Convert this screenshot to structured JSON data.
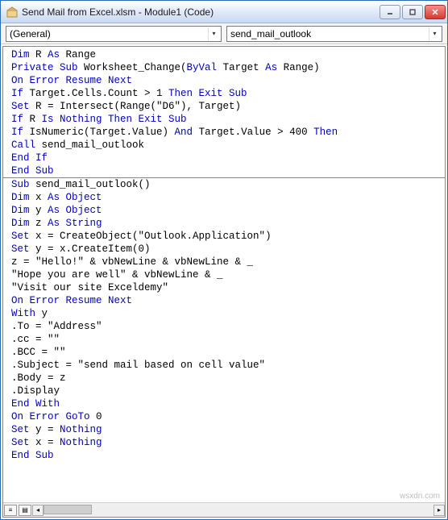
{
  "window": {
    "title": "Send Mail from Excel.xlsm - Module1 (Code)"
  },
  "toolbar": {
    "object_combo": "(General)",
    "proc_combo": "send_mail_outlook"
  },
  "code": {
    "line1_a": "Dim",
    "line1_b": " R ",
    "line1_c": "As",
    "line1_d": " Range",
    "line2_a": "Private Sub",
    "line2_b": " Worksheet_Change(",
    "line2_c": "ByVal",
    "line2_d": " Target ",
    "line2_e": "As",
    "line2_f": " Range)",
    "line3_a": "On Error Resume Next",
    "line4_a": "If",
    "line4_b": " Target.Cells.Count > 1 ",
    "line4_c": "Then Exit Sub",
    "line5_a": "Set",
    "line5_b": " R = Intersect(Range(\"D6\"), Target)",
    "line6_a": "If",
    "line6_b": " R ",
    "line6_c": "Is Nothing Then Exit Sub",
    "line7_a": "If",
    "line7_b": " IsNumeric(Target.Value) ",
    "line7_c": "And",
    "line7_d": " Target.Value > 400 ",
    "line7_e": "Then",
    "line8_a": "Call",
    "line8_b": " send_mail_outlook",
    "line9_a": "End If",
    "line10_a": "End Sub",
    "line11_a": "Sub",
    "line11_b": " send_mail_outlook()",
    "line12_a": "Dim",
    "line12_b": " x ",
    "line12_c": "As Object",
    "line13_a": "Dim",
    "line13_b": " y ",
    "line13_c": "As Object",
    "line14_a": "Dim",
    "line14_b": " z ",
    "line14_c": "As String",
    "line15_a": "Set",
    "line15_b": " x = CreateObject(\"Outlook.Application\")",
    "line16_a": "Set",
    "line16_b": " y = x.CreateItem(0)",
    "line17_a": "z = \"Hello!\" & vbNewLine & vbNewLine & _",
    "line18_a": "\"Hope you are well\" & vbNewLine & _",
    "line19_a": "\"Visit our site Exceldemy\"",
    "line20_a": "On Error Resume Next",
    "line21_a": "With",
    "line21_b": " y",
    "line22_a": ".To = \"Address\"",
    "line23_a": ".cc = \"\"",
    "line24_a": ".BCC = \"\"",
    "line25_a": ".Subject = \"send mail based on cell value\"",
    "line26_a": ".Body = z",
    "line27_a": ".Display",
    "line28_a": "End With",
    "line29_a": "On Error GoTo",
    "line29_b": " 0",
    "line30_a": "Set",
    "line30_b": " y = ",
    "line30_c": "Nothing",
    "line31_a": "Set",
    "line31_b": " x = ",
    "line31_c": "Nothing",
    "line32_a": "End Sub"
  },
  "watermark": "wsxdn.com"
}
